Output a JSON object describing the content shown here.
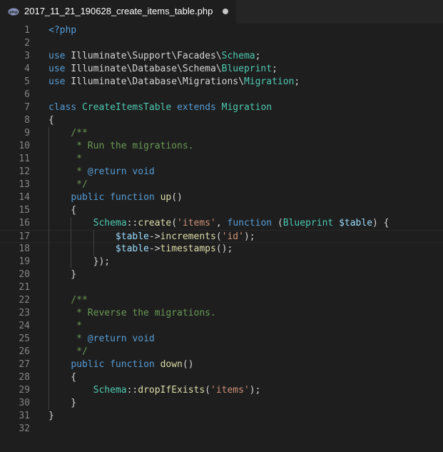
{
  "tab": {
    "title": "2017_11_21_190628_create_items_table.php",
    "icon": "php-file-icon",
    "dirty": true
  },
  "editor": {
    "current_line": 17,
    "lines": [
      {
        "n": "1",
        "tokens": [
          {
            "t": "<?php",
            "c": "tag"
          }
        ]
      },
      {
        "n": "2",
        "tokens": []
      },
      {
        "n": "3",
        "tokens": [
          {
            "t": "use",
            "c": "kw"
          },
          {
            "t": " Illuminate\\Support\\Facades\\",
            "c": "ns"
          },
          {
            "t": "Schema",
            "c": "cls"
          },
          {
            "t": ";",
            "c": "punc"
          }
        ]
      },
      {
        "n": "4",
        "tokens": [
          {
            "t": "use",
            "c": "kw"
          },
          {
            "t": " Illuminate\\Database\\Schema\\",
            "c": "ns"
          },
          {
            "t": "Blueprint",
            "c": "cls"
          },
          {
            "t": ";",
            "c": "punc"
          }
        ]
      },
      {
        "n": "5",
        "tokens": [
          {
            "t": "use",
            "c": "kw"
          },
          {
            "t": " Illuminate\\Database\\Migrations\\",
            "c": "ns"
          },
          {
            "t": "Migration",
            "c": "cls"
          },
          {
            "t": ";",
            "c": "punc"
          }
        ]
      },
      {
        "n": "6",
        "tokens": []
      },
      {
        "n": "7",
        "tokens": [
          {
            "t": "class",
            "c": "kw"
          },
          {
            "t": " ",
            "c": "punc"
          },
          {
            "t": "CreateItemsTable",
            "c": "cls"
          },
          {
            "t": " ",
            "c": "punc"
          },
          {
            "t": "extends",
            "c": "kw"
          },
          {
            "t": " ",
            "c": "punc"
          },
          {
            "t": "Migration",
            "c": "cls"
          }
        ]
      },
      {
        "n": "8",
        "tokens": [
          {
            "t": "{",
            "c": "punc"
          }
        ]
      },
      {
        "n": "9",
        "tokens": [
          {
            "t": "    /**",
            "c": "cmt"
          }
        ]
      },
      {
        "n": "10",
        "tokens": [
          {
            "t": "     * Run the migrations.",
            "c": "cmt"
          }
        ]
      },
      {
        "n": "11",
        "tokens": [
          {
            "t": "     *",
            "c": "cmt"
          }
        ]
      },
      {
        "n": "12",
        "tokens": [
          {
            "t": "     * ",
            "c": "cmt"
          },
          {
            "t": "@return",
            "c": "kw"
          },
          {
            "t": " ",
            "c": "cmt"
          },
          {
            "t": "void",
            "c": "kw"
          }
        ]
      },
      {
        "n": "13",
        "tokens": [
          {
            "t": "     */",
            "c": "cmt"
          }
        ]
      },
      {
        "n": "14",
        "tokens": [
          {
            "t": "    ",
            "c": "punc"
          },
          {
            "t": "public",
            "c": "kw"
          },
          {
            "t": " ",
            "c": "punc"
          },
          {
            "t": "function",
            "c": "kw"
          },
          {
            "t": " ",
            "c": "punc"
          },
          {
            "t": "up",
            "c": "fn"
          },
          {
            "t": "()",
            "c": "punc"
          }
        ]
      },
      {
        "n": "15",
        "tokens": [
          {
            "t": "    {",
            "c": "punc"
          }
        ]
      },
      {
        "n": "16",
        "tokens": [
          {
            "t": "        ",
            "c": "punc"
          },
          {
            "t": "Schema",
            "c": "cls"
          },
          {
            "t": "::",
            "c": "op"
          },
          {
            "t": "create",
            "c": "fn"
          },
          {
            "t": "(",
            "c": "punc"
          },
          {
            "t": "'items'",
            "c": "str"
          },
          {
            "t": ", ",
            "c": "punc"
          },
          {
            "t": "function",
            "c": "kw"
          },
          {
            "t": " (",
            "c": "punc"
          },
          {
            "t": "Blueprint",
            "c": "cls"
          },
          {
            "t": " ",
            "c": "punc"
          },
          {
            "t": "$table",
            "c": "var"
          },
          {
            "t": ") {",
            "c": "punc"
          }
        ]
      },
      {
        "n": "17",
        "tokens": [
          {
            "t": "            ",
            "c": "punc"
          },
          {
            "t": "$table",
            "c": "var"
          },
          {
            "t": "->",
            "c": "op"
          },
          {
            "t": "increments",
            "c": "fn"
          },
          {
            "t": "(",
            "c": "punc"
          },
          {
            "t": "'id'",
            "c": "str"
          },
          {
            "t": ");",
            "c": "punc"
          }
        ]
      },
      {
        "n": "18",
        "tokens": [
          {
            "t": "            ",
            "c": "punc"
          },
          {
            "t": "$table",
            "c": "var"
          },
          {
            "t": "->",
            "c": "op"
          },
          {
            "t": "timestamps",
            "c": "fn"
          },
          {
            "t": "();",
            "c": "punc"
          }
        ]
      },
      {
        "n": "19",
        "tokens": [
          {
            "t": "        });",
            "c": "punc"
          }
        ]
      },
      {
        "n": "20",
        "tokens": [
          {
            "t": "    }",
            "c": "punc"
          }
        ]
      },
      {
        "n": "21",
        "tokens": []
      },
      {
        "n": "22",
        "tokens": [
          {
            "t": "    /**",
            "c": "cmt"
          }
        ]
      },
      {
        "n": "23",
        "tokens": [
          {
            "t": "     * Reverse the migrations.",
            "c": "cmt"
          }
        ]
      },
      {
        "n": "24",
        "tokens": [
          {
            "t": "     *",
            "c": "cmt"
          }
        ]
      },
      {
        "n": "25",
        "tokens": [
          {
            "t": "     * ",
            "c": "cmt"
          },
          {
            "t": "@return",
            "c": "kw"
          },
          {
            "t": " ",
            "c": "cmt"
          },
          {
            "t": "void",
            "c": "kw"
          }
        ]
      },
      {
        "n": "26",
        "tokens": [
          {
            "t": "     */",
            "c": "cmt"
          }
        ]
      },
      {
        "n": "27",
        "tokens": [
          {
            "t": "    ",
            "c": "punc"
          },
          {
            "t": "public",
            "c": "kw"
          },
          {
            "t": " ",
            "c": "punc"
          },
          {
            "t": "function",
            "c": "kw"
          },
          {
            "t": " ",
            "c": "punc"
          },
          {
            "t": "down",
            "c": "fn"
          },
          {
            "t": "()",
            "c": "punc"
          }
        ]
      },
      {
        "n": "28",
        "tokens": [
          {
            "t": "    {",
            "c": "punc"
          }
        ]
      },
      {
        "n": "29",
        "tokens": [
          {
            "t": "        ",
            "c": "punc"
          },
          {
            "t": "Schema",
            "c": "cls"
          },
          {
            "t": "::",
            "c": "op"
          },
          {
            "t": "dropIfExists",
            "c": "fn"
          },
          {
            "t": "(",
            "c": "punc"
          },
          {
            "t": "'items'",
            "c": "str"
          },
          {
            "t": ");",
            "c": "punc"
          }
        ]
      },
      {
        "n": "30",
        "tokens": [
          {
            "t": "    }",
            "c": "punc"
          }
        ]
      },
      {
        "n": "31",
        "tokens": [
          {
            "t": "}",
            "c": "punc"
          }
        ]
      },
      {
        "n": "32",
        "tokens": []
      }
    ]
  },
  "colors": {
    "background": "#1e1e1e",
    "tabbar": "#252526",
    "keyword": "#569cd6",
    "class": "#4ec9b0",
    "function": "#dcdcaa",
    "variable": "#9cdcfe",
    "string": "#ce9178",
    "comment": "#6a9955",
    "line_number": "#858585"
  }
}
